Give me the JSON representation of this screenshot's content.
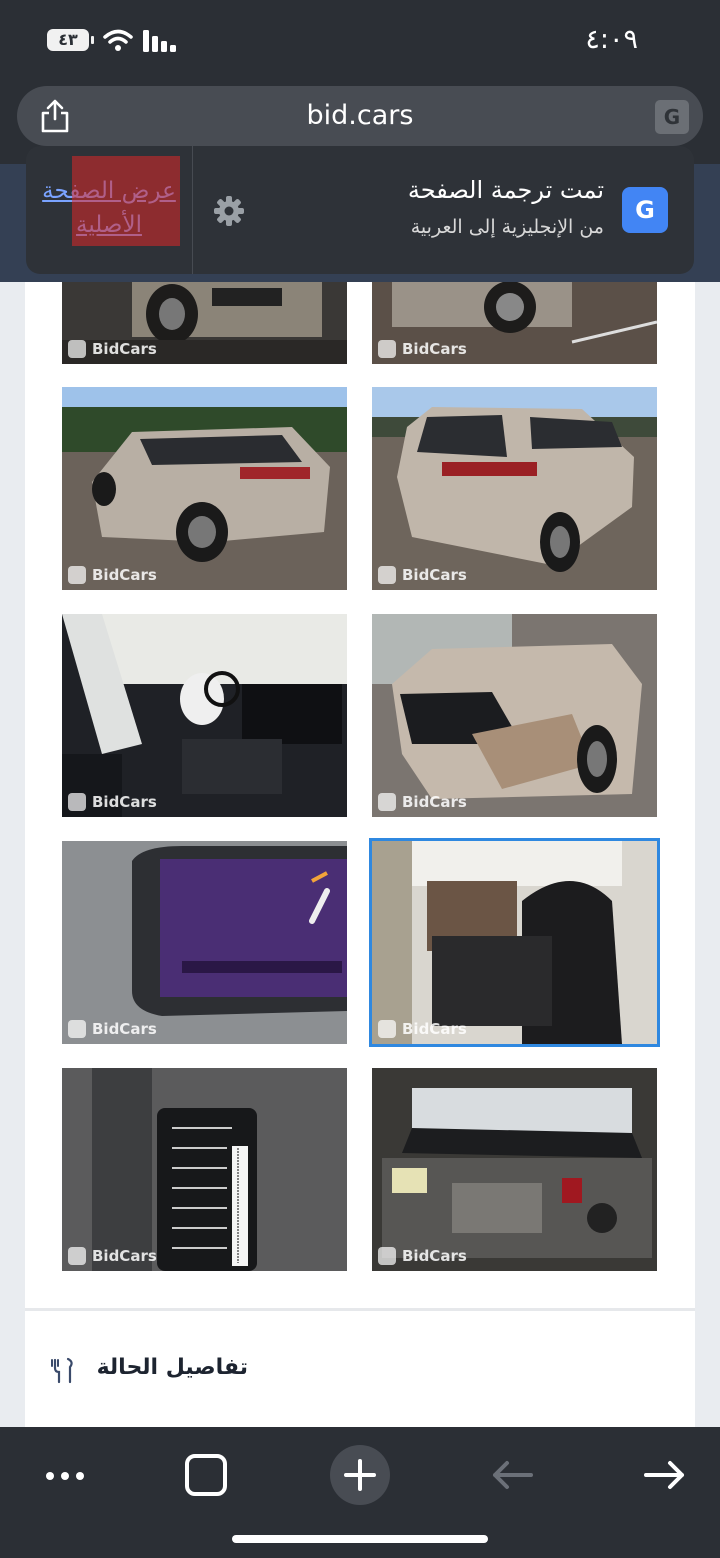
{
  "status_bar": {
    "battery": "٤٣",
    "time": "٤:٠٩"
  },
  "browser": {
    "url": "bid.cars",
    "translate_mini_glyph": "G"
  },
  "translate_popup": {
    "title": "تمت ترجمة الصفحة",
    "subtitle": "من الإنجليزية إلى العربية",
    "show_original": "عرض الصفحة الأصلية",
    "icon_glyph": "G"
  },
  "gallery": {
    "watermark": "BidCars",
    "photos": [
      {
        "desc": "front-partial-left"
      },
      {
        "desc": "front-partial-right"
      },
      {
        "desc": "rear-left"
      },
      {
        "desc": "rear-right"
      },
      {
        "desc": "interior-airbag"
      },
      {
        "desc": "front-damage"
      },
      {
        "desc": "dashboard-cluster"
      },
      {
        "desc": "rear-seats",
        "selected": true
      },
      {
        "desc": "vin-sticker"
      },
      {
        "desc": "engine-bay"
      }
    ]
  },
  "section": {
    "condition_title": "تفاصيل الحالة"
  },
  "colors": {
    "accent": "#2f88e0",
    "dark": "#2b2f35",
    "link": "#7aa3ff"
  }
}
